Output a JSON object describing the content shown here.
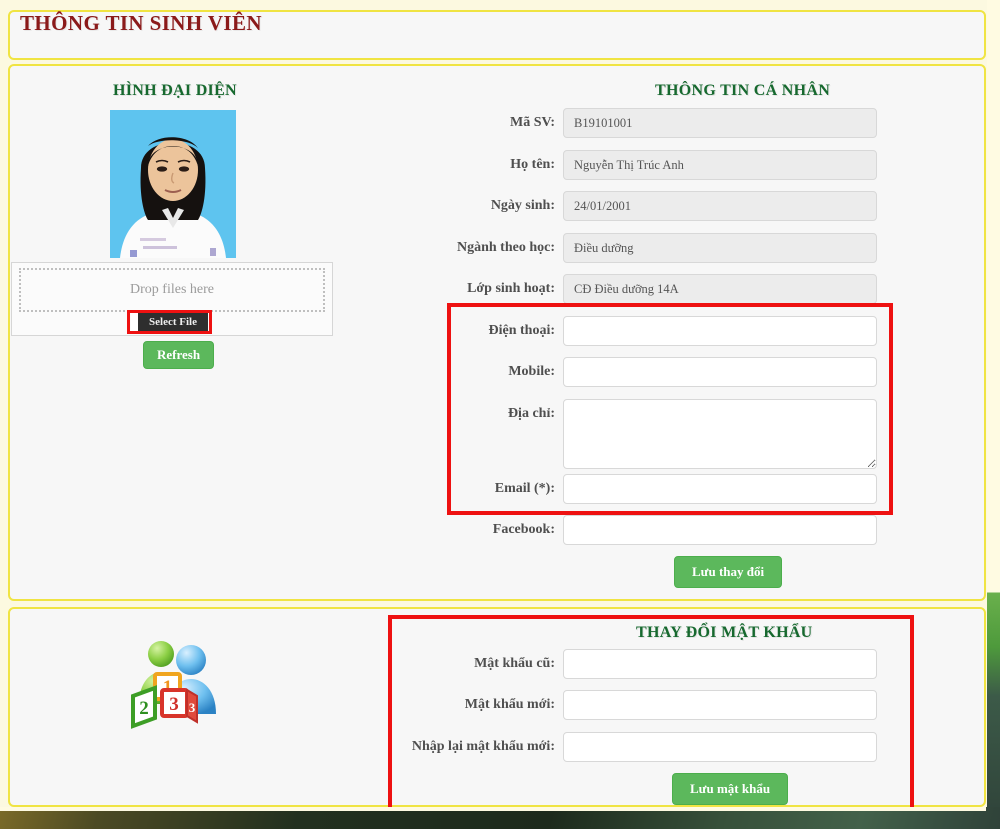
{
  "header": {
    "title": "THÔNG TIN SINH VIÊN"
  },
  "avatar": {
    "section_title": "HÌNH ĐẠI DIỆN",
    "dropzone_text": "Drop files here",
    "select_file_label": "Select File",
    "refresh_label": "Refresh"
  },
  "personal": {
    "section_title": "THÔNG TIN CÁ NHÂN",
    "fields": [
      {
        "label": "Mã SV:",
        "value": "B19101001",
        "readonly": true
      },
      {
        "label": "Họ tên:",
        "value": "Nguyễn Thị Trúc Anh",
        "readonly": true
      },
      {
        "label": "Ngày sinh:",
        "value": "24/01/2001",
        "readonly": true
      },
      {
        "label": "Ngành theo học:",
        "value": "Điều dưỡng",
        "readonly": true
      },
      {
        "label": "Lớp sinh hoạt:",
        "value": "CĐ Điều dưỡng 14A",
        "readonly": true
      },
      {
        "label": "Điện thoại:",
        "value": "",
        "readonly": false
      },
      {
        "label": "Mobile:",
        "value": "",
        "readonly": false
      },
      {
        "label": "Địa chỉ:",
        "value": "",
        "readonly": false
      },
      {
        "label": "Email (*):",
        "value": "",
        "readonly": false
      },
      {
        "label": "Facebook:",
        "value": "",
        "readonly": false
      }
    ],
    "save_label": "Lưu thay đổi"
  },
  "password": {
    "section_title": "THAY ĐỔI MẬT KHẨU",
    "fields": [
      {
        "label": "Mật khẩu cũ:",
        "value": ""
      },
      {
        "label": "Mật khẩu mới:",
        "value": ""
      },
      {
        "label": "Nhập lại mật khẩu mới:",
        "value": ""
      }
    ],
    "save_label": "Lưu mật khẩu"
  },
  "colors": {
    "panel_border": "#f0e442",
    "title_red": "#8b1a1a",
    "heading_green": "#17692f",
    "button_green": "#5cb85c",
    "annotation_red": "#ee1111",
    "accent_green": "#6ab04c"
  }
}
